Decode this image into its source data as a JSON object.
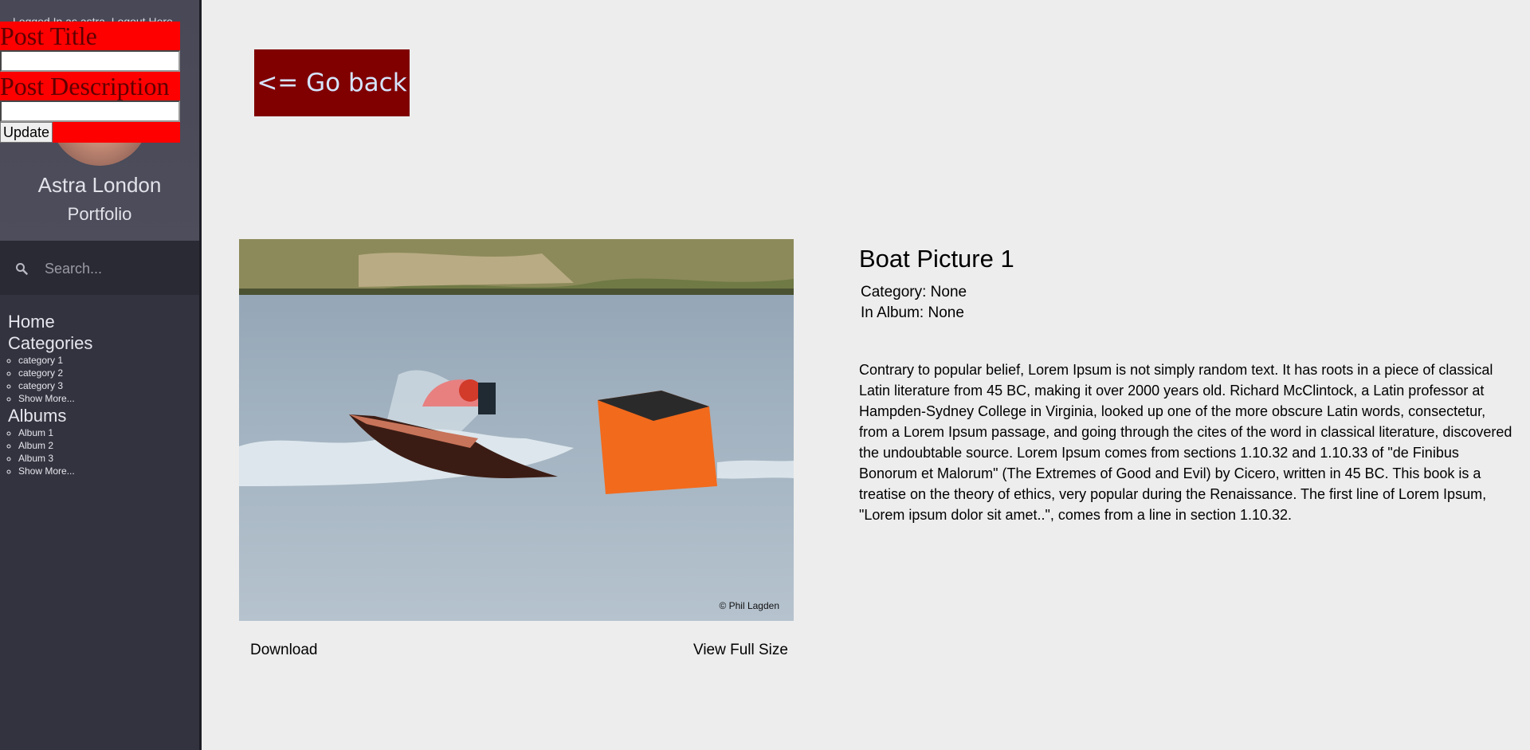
{
  "sidebar": {
    "login_text": "Logged In as astra. Logout Here",
    "profile": {
      "name": "Astra London",
      "subtitle": "Portfolio"
    },
    "search": {
      "placeholder": "Search..."
    },
    "nav": {
      "home": "Home",
      "categories": {
        "label": "Categories",
        "items": [
          "category 1",
          "category 2",
          "category 3",
          "Show More..."
        ]
      },
      "albums": {
        "label": "Albums",
        "items": [
          "Album 1",
          "Album 2",
          "Album 3",
          "Show More..."
        ]
      }
    }
  },
  "edit_form": {
    "title_label": "Post Title",
    "title_value": "",
    "description_label": "Post Description",
    "description_value": "",
    "update_label": "Update"
  },
  "main": {
    "go_back": "<= Go back",
    "photo": {
      "credit": "© Phil Lagden"
    },
    "download": "Download",
    "view_full": "View Full Size",
    "post": {
      "title": "Boat Picture 1",
      "category": "Category: None",
      "album": "In Album: None",
      "description": "Contrary to popular belief, Lorem Ipsum is not simply random text. It has roots in a piece of classical Latin literature from 45 BC, making it over 2000 years old. Richard McClintock, a Latin professor at Hampden-Sydney College in Virginia, looked up one of the more obscure Latin words, consectetur, from a Lorem Ipsum passage, and going through the cites of the word in classical literature, discovered the undoubtable source. Lorem Ipsum comes from sections 1.10.32 and 1.10.33 of \"de Finibus Bonorum et Malorum\" (The Extremes of Good and Evil) by Cicero, written in 45 BC. This book is a treatise on the theory of ethics, very popular during the Renaissance. The first line of Lorem Ipsum, \"Lorem ipsum dolor sit amet..\", comes from a line in section 1.10.32."
    }
  },
  "colors": {
    "sidebar": "#33333f",
    "go_back_bg": "#800000",
    "form_bg": "#ff0000",
    "page_bg": "#ededed"
  }
}
